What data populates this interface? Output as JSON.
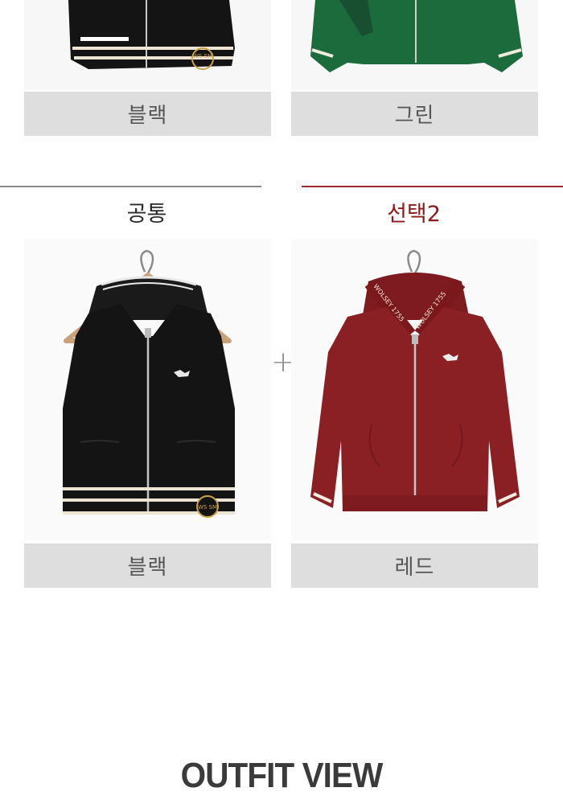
{
  "top_row": {
    "left_label": "블랙",
    "right_label": "그린"
  },
  "bottom_row": {
    "left_header": "공통",
    "right_header": "선택2",
    "plus": "+",
    "left_label": "블랙",
    "right_label": "레드"
  },
  "logo_text": "WS SM",
  "neck_tape_text": "WOLSEY 1755",
  "outfit_title": "OUTFIT VIEW",
  "colors": {
    "black_knit": "#141414",
    "green_knit": "#1c6b3d",
    "red_knit": "#8a1f24",
    "label_bg": "#dedede",
    "divider_gray": "#8c8c8c",
    "divider_red": "#9b2a2a",
    "header_red": "#8b1a1a"
  },
  "icons": [
    "hanger-icon",
    "fox-logo-icon",
    "plus-icon"
  ]
}
